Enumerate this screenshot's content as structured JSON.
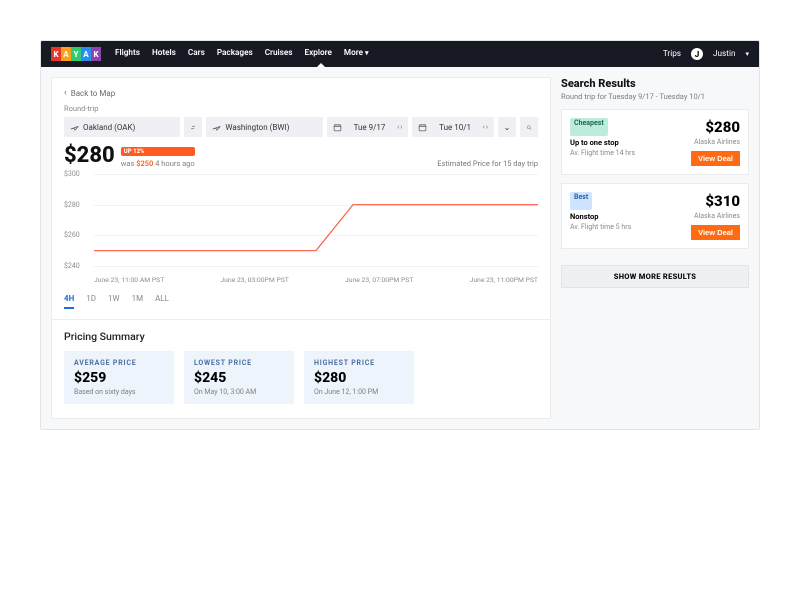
{
  "nav": {
    "items": [
      "Flights",
      "Hotels",
      "Cars",
      "Packages",
      "Cruises",
      "Explore",
      "More"
    ],
    "trips": "Trips",
    "user_initial": "J",
    "user_name": "Justin"
  },
  "back_label": "Back to Map",
  "trip_type": "Round-trip",
  "search": {
    "origin": "Oakland (OAK)",
    "dest": "Washington (BWI)",
    "depart": "Tue 9/17",
    "return": "Tue 10/1"
  },
  "price": {
    "current": "$280",
    "up_badge": "UP 12%",
    "was_prefix": "was ",
    "was_value": "$250",
    "was_suffix": " 4 hours ago",
    "estimate_note": "Estimated Price for 15 day trip"
  },
  "chart_data": {
    "type": "line",
    "title": "",
    "xlabel": "",
    "ylabel": "",
    "ylim": [
      240,
      300
    ],
    "yticks": [
      240,
      260,
      280,
      300
    ],
    "x_categories": [
      "June 23, 11:00 AM PST",
      "June 23, 03:00PM PST",
      "June 23, 07:00PM PST",
      "June 23, 11:00PM PST"
    ],
    "values": [
      250,
      250,
      250,
      250,
      250,
      250,
      250,
      280,
      280,
      280,
      280,
      280,
      280
    ]
  },
  "ranges": [
    "4H",
    "1D",
    "1W",
    "1M",
    "ALL"
  ],
  "range_active": 0,
  "summary": {
    "title": "Pricing Summary",
    "cards": [
      {
        "label": "AVERAGE PRICE",
        "value": "$259",
        "sub": "Based on sixty days"
      },
      {
        "label": "LOWEST PRICE",
        "value": "$245",
        "sub": "On May 10, 3:00 AM"
      },
      {
        "label": "HIGHEST PRICE",
        "value": "$280",
        "sub": "On June 12, 1:00 PM"
      }
    ]
  },
  "results": {
    "title": "Search Results",
    "subtitle": "Round trip for Tuesday 9/17 - Tuesday 10/1",
    "deals": [
      {
        "tag": "Cheapest",
        "tag_style": "cheap",
        "price": "$280",
        "stops": "Up to one stop",
        "airline": "Alaska Airlines",
        "flight_time": "Av. Flight time 14 hrs",
        "cta": "View Deal"
      },
      {
        "tag": "Best",
        "tag_style": "best",
        "price": "$310",
        "stops": "Nonstop",
        "airline": "Alaska Airlines",
        "flight_time": "Av. Flight time 5 hrs",
        "cta": "View Deal"
      }
    ],
    "more": "SHOW MORE RESULTS"
  }
}
